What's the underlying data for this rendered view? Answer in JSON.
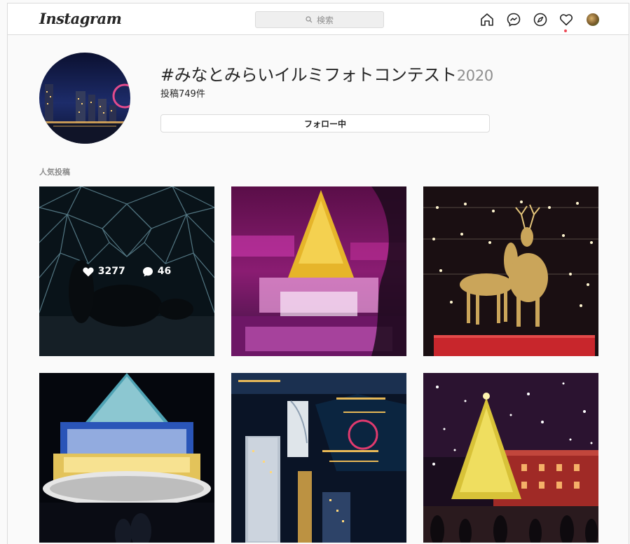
{
  "header": {
    "logo_text": "Instagram",
    "search_placeholder": "検索",
    "nav_icons": [
      "home-icon",
      "messenger-icon",
      "explore-icon",
      "heart-icon",
      "profile-avatar"
    ]
  },
  "hashtag_page": {
    "title_main": "#みなとみらいイルミフォトコンテスト",
    "title_year": "2020",
    "posts_count": "投稿749件",
    "follow_label": "フォロー中",
    "section_label": "人気投稿"
  },
  "top_posts": [
    {
      "likes": "3277",
      "comments": "46",
      "hover": true,
      "scene": "dome-night"
    },
    {
      "hover": false,
      "scene": "golden-tree-pink"
    },
    {
      "hover": false,
      "scene": "golden-deer"
    },
    {
      "hover": false,
      "scene": "blue-white-tree"
    },
    {
      "hover": false,
      "scene": "aerial-minatomirai"
    },
    {
      "hover": false,
      "scene": "red-brick-tree-snow"
    }
  ],
  "colors": {
    "accent_notification": "#ed4956",
    "border": "#dbdbdb",
    "background": "#fafafa"
  }
}
